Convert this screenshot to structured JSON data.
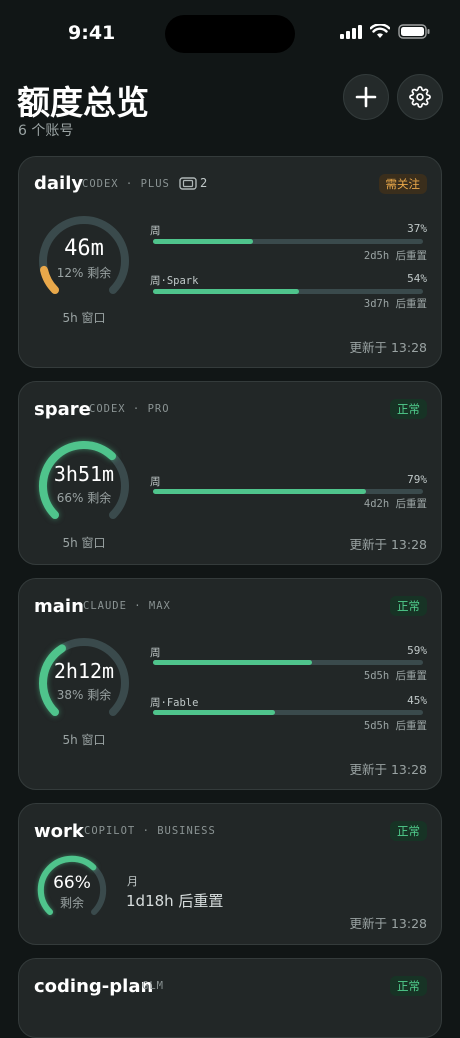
{
  "status": {
    "time": "9:41"
  },
  "header": {
    "title": "额度总览",
    "subtitle": "6 个账号"
  },
  "icons": {
    "add": "plus-icon",
    "settings": "gear-icon",
    "device": "device-icon"
  },
  "colors": {
    "ok": "#4fc48c",
    "warn": "#e9a84a",
    "track": "#3a4a4c"
  },
  "cards": [
    {
      "name": "daily",
      "meta": "CODEX · PLUS",
      "device_count": "2",
      "badge": "需关注",
      "badge_state": "warn",
      "gauge": {
        "value": "46m",
        "sub": "12% 剩余",
        "label": "5h 窗口",
        "fraction": 0.12,
        "state": "warn"
      },
      "bars": [
        {
          "label": "周",
          "pct": "37%",
          "fraction": 0.37,
          "reset": "2d5h 后重置"
        },
        {
          "label": "周·Spark",
          "pct": "54%",
          "fraction": 0.54,
          "reset": "3d7h 后重置"
        }
      ],
      "updated": "更新于 13:28"
    },
    {
      "name": "spare",
      "meta": "CODEX · PRO",
      "badge": "正常",
      "badge_state": "ok",
      "gauge": {
        "value": "3h51m",
        "sub": "66% 剩余",
        "label": "5h 窗口",
        "fraction": 0.66,
        "state": "ok"
      },
      "bars": [
        {
          "label": "周",
          "pct": "79%",
          "fraction": 0.79,
          "reset": "4d2h 后重置"
        }
      ],
      "updated": "更新于 13:28"
    },
    {
      "name": "main",
      "meta": "CLAUDE · MAX",
      "badge": "正常",
      "badge_state": "ok",
      "gauge": {
        "value": "2h12m",
        "sub": "38% 剩余",
        "label": "5h 窗口",
        "fraction": 0.38,
        "state": "ok"
      },
      "bars": [
        {
          "label": "周",
          "pct": "59%",
          "fraction": 0.59,
          "reset": "5d5h 后重置"
        },
        {
          "label": "周·Fable",
          "pct": "45%",
          "fraction": 0.45,
          "reset": "5d5h 后重置"
        }
      ],
      "updated": "更新于 13:28"
    },
    {
      "name": "work",
      "meta": "COPILOT · BUSINESS",
      "badge": "正常",
      "badge_state": "ok",
      "gauge": {
        "value": "66%",
        "sub": "剩余",
        "fraction": 0.66,
        "state": "ok"
      },
      "monthly": {
        "label": "月",
        "reset": "1d18h 后重置"
      },
      "updated": "更新于 13:28"
    },
    {
      "name": "coding-plan",
      "meta": "GLM",
      "badge": "正常",
      "badge_state": "ok"
    }
  ]
}
